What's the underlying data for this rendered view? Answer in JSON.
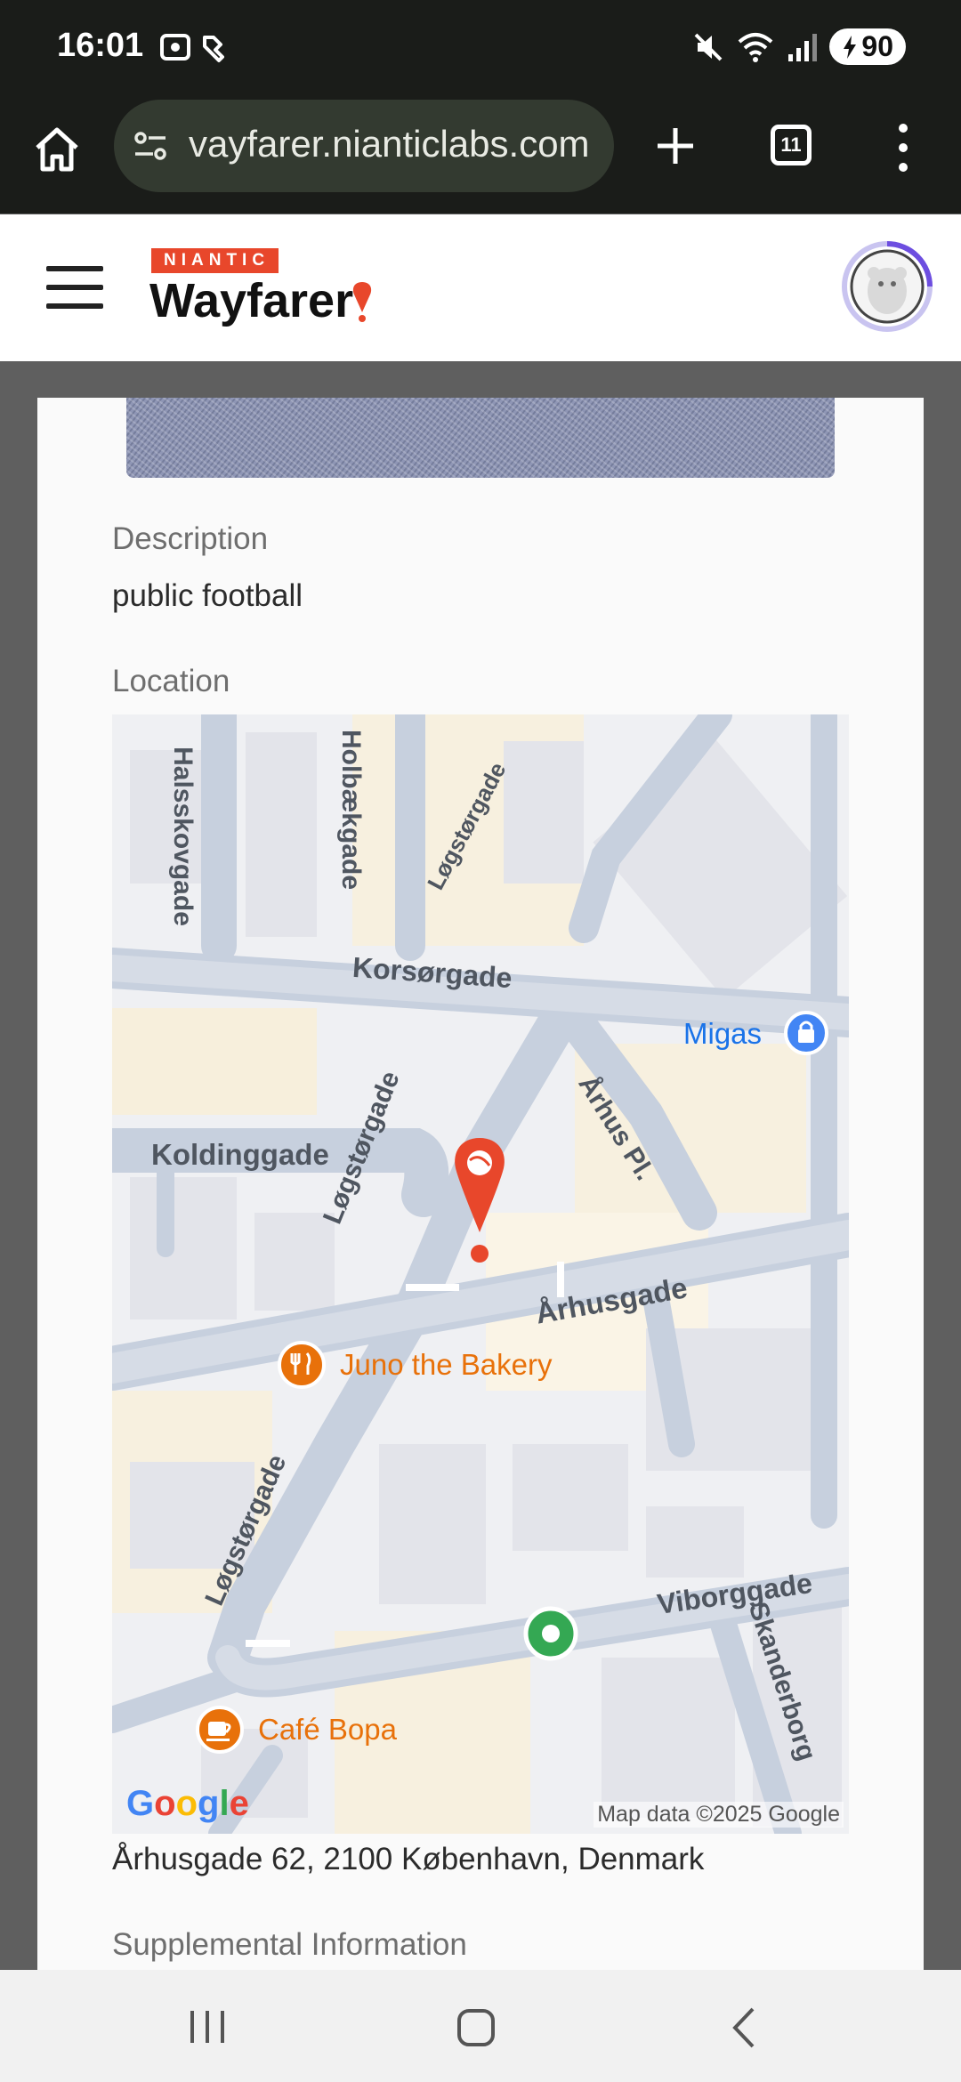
{
  "status_bar": {
    "time": "16:01",
    "battery": "90",
    "icons": [
      "screenshot-icon",
      "nfc-icon",
      "mute-icon",
      "wifi-icon",
      "signal-icon",
      "battery-charging-icon"
    ]
  },
  "browser": {
    "url": "vayfarer.nianticlabs.com",
    "tab_count": "11",
    "icons": [
      "home-icon",
      "site-settings-icon",
      "new-tab-icon",
      "tabs-icon",
      "more-menu-icon"
    ]
  },
  "header": {
    "brand_badge": "NIANTIC",
    "brand_name": "Wayfarer",
    "icons": [
      "menu-icon",
      "wayfarer-pin-icon",
      "avatar-icon"
    ],
    "accent_color": "#e8472b"
  },
  "submission": {
    "description_label": "Description",
    "description_value": "public football",
    "location_label": "Location",
    "address": "Århusgade 62, 2100 København, Denmark",
    "supplemental_label": "Supplemental Information"
  },
  "map": {
    "streets": {
      "halsskovgade": "Halsskovgade",
      "holbaekgade": "Holbækgade",
      "logstorgade_top": "Løgstørgade",
      "korsorgade": "Korsørgade",
      "migas": "Migas",
      "koldinggade": "Koldinggade",
      "logstorgade_mid": "Løgstørgade",
      "arhus_pl": "Århus Pl.",
      "arhusgade": "Århusgade",
      "juno": "Juno the Bakery",
      "logstorgade_low": "Løgstørgade",
      "viborggade": "Viborggade",
      "skanderborg": "Skanderborg",
      "cafe_bopa": "Café Bopa"
    },
    "google_logo": "Google",
    "attribution": "Map data ©2025 Google",
    "icons": [
      "map-marker-icon",
      "shopping-bag-icon",
      "restaurant-icon",
      "cafe-icon",
      "poi-green-icon"
    ]
  },
  "nav": {
    "icons": [
      "recents-icon",
      "home-nav-icon",
      "back-icon"
    ]
  }
}
